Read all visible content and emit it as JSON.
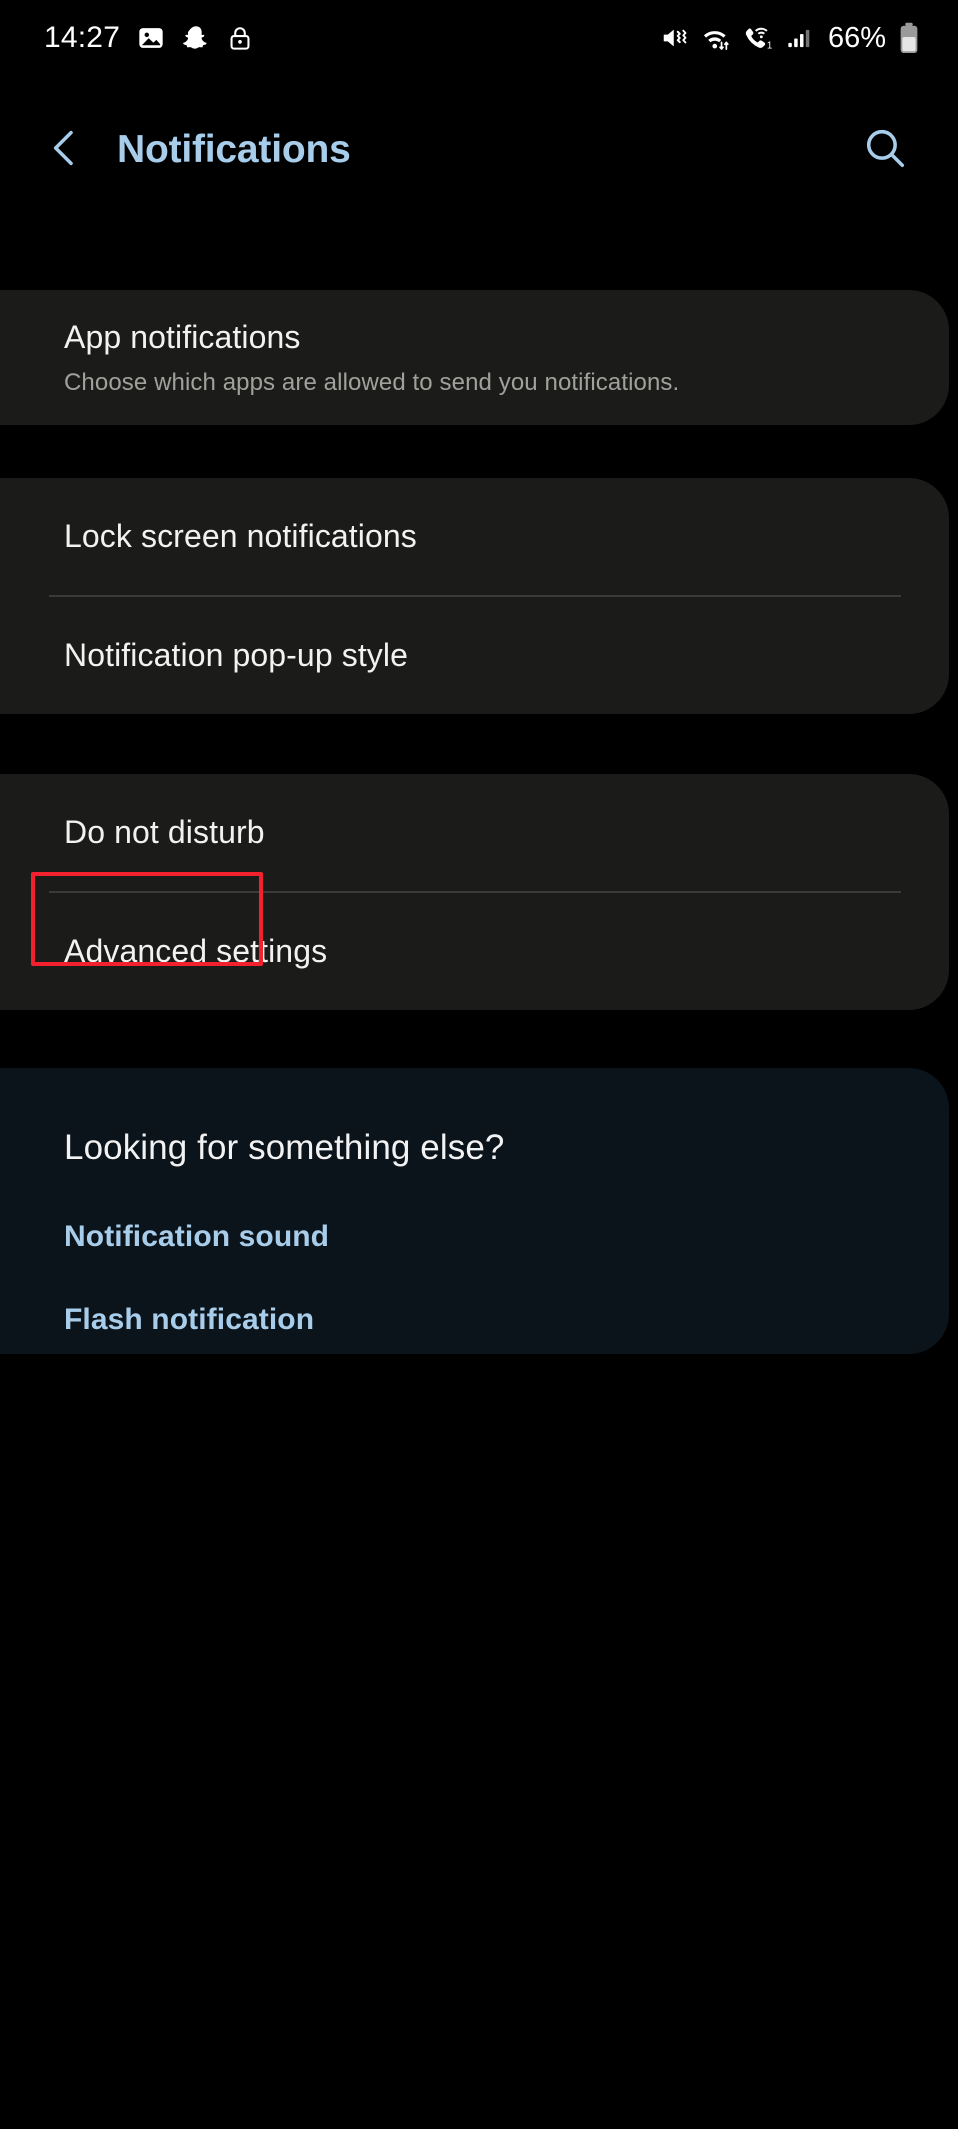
{
  "status_bar": {
    "time": "14:27",
    "left_icons": [
      "gallery-icon",
      "snapchat-icon",
      "lock-icon"
    ],
    "right_icons": [
      "mute-vibrate-icon",
      "wifi-data-icon",
      "wifi-calling-icon",
      "signal-bars-icon"
    ],
    "wifi_calling_sim": "1",
    "battery_percent": "66%"
  },
  "header": {
    "back_icon": "chevron-left-icon",
    "title": "Notifications",
    "search_icon": "search-icon",
    "title_color": "#a8cdeb"
  },
  "cards": {
    "app_notifications": {
      "title": "App notifications",
      "subtitle": "Choose which apps are allowed to send you notifications."
    },
    "lock_screen": {
      "title": "Lock screen notifications"
    },
    "popup_style": {
      "title": "Notification pop-up style"
    },
    "do_not_disturb": {
      "title": "Do not disturb"
    },
    "advanced_settings": {
      "title": "Advanced settings"
    },
    "looking_for": {
      "title": "Looking for something else?",
      "links": [
        {
          "label": "Notification sound"
        },
        {
          "label": "Flash notification"
        }
      ]
    }
  },
  "highlight": {
    "target": "do-not-disturb-row",
    "color": "#f3212e"
  },
  "colors": {
    "background": "#000000",
    "card": "#1b1b19",
    "accent_card": "#0c141b",
    "primary_text": "#f2f2f2",
    "secondary_text": "#a0a09d",
    "accent": "#a8cdeb",
    "divider": "#3a3a38",
    "highlight": "#f3212e"
  }
}
